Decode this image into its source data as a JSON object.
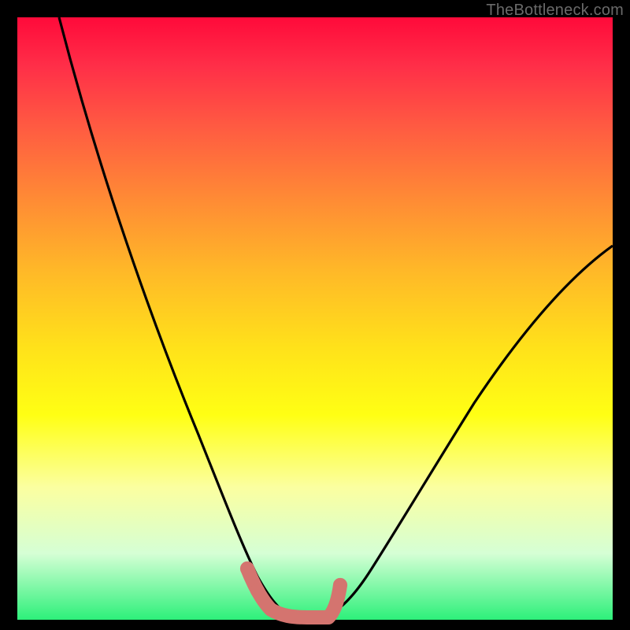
{
  "watermark": "TheBottleneck.com",
  "chart_data": {
    "type": "line",
    "title": "",
    "xlabel": "",
    "ylabel": "",
    "xlim": [
      0,
      100
    ],
    "ylim": [
      0,
      100
    ],
    "grid": false,
    "legend": false,
    "series": [
      {
        "name": "bottleneck-curve",
        "x": [
          7,
          10,
          14,
          18,
          22,
          26,
          30,
          33,
          36,
          38,
          40,
          42,
          44,
          46,
          48,
          52,
          56,
          60,
          66,
          74,
          82,
          90,
          100
        ],
        "y": [
          100,
          89,
          77,
          66,
          55,
          44,
          33,
          24,
          16,
          10,
          6,
          3,
          1,
          0,
          0,
          0,
          2,
          6,
          13,
          24,
          36,
          47,
          59
        ]
      },
      {
        "name": "optimal-range-marker",
        "x": [
          38,
          40,
          42,
          44,
          46,
          48,
          50,
          52,
          53
        ],
        "y": [
          8,
          3,
          1,
          0,
          0,
          0,
          0,
          1,
          5
        ]
      }
    ]
  }
}
